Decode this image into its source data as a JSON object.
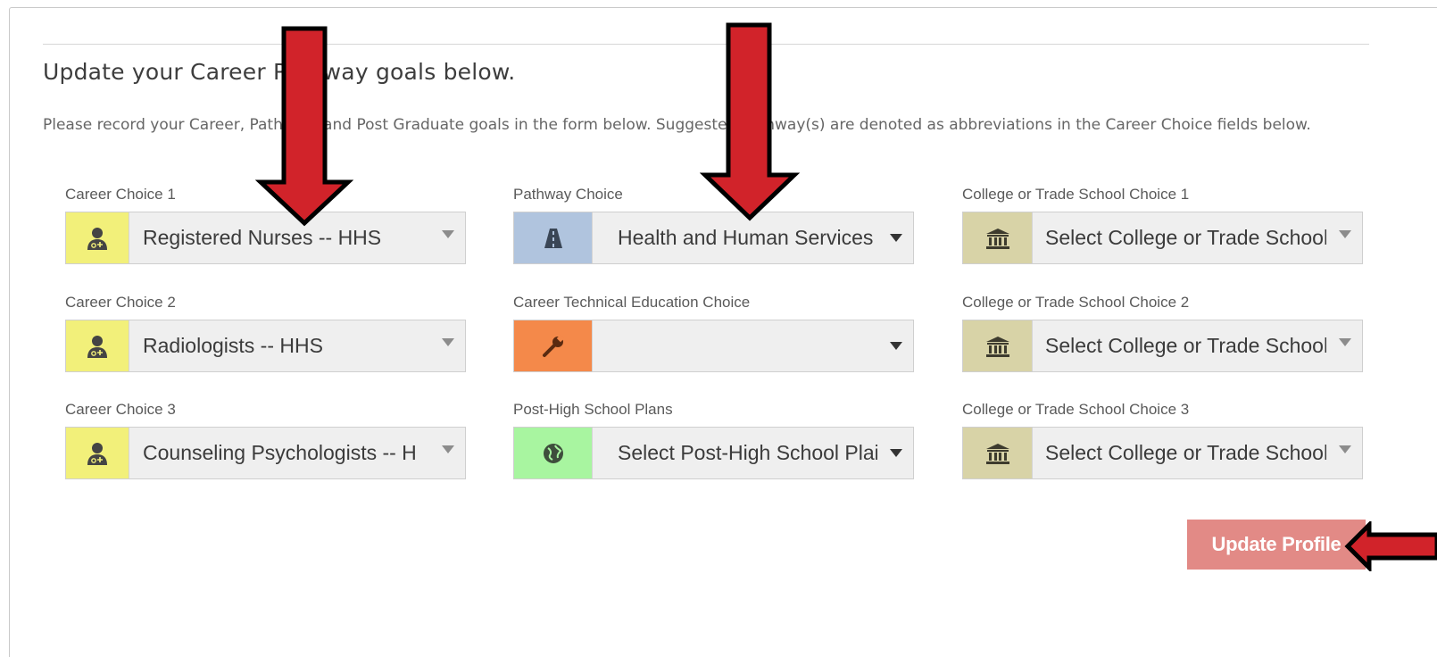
{
  "heading": "Update your Career Pathway goals below.",
  "intro": "Please record your Career, Pathway, and Post Graduate goals in the form below. Suggested Pathway(s) are denoted as abbreviations in the Career Choice fields below.",
  "colors": {
    "career_addon": "#f2f07a",
    "pathway_addon": "#b0c4de",
    "cte_addon": "#f4894a",
    "post_hs_addon": "#a8f5a0",
    "college_addon": "#d8d3a7",
    "update_button": "#e28a86",
    "annotation_arrow": "#d1232a"
  },
  "career_choices": [
    {
      "label": "Career Choice 1",
      "value": "Registered Nurses -- HHS",
      "icon": "doctor-icon"
    },
    {
      "label": "Career Choice 2",
      "value": "Radiologists -- HHS",
      "icon": "doctor-icon"
    },
    {
      "label": "Career Choice 3",
      "value": "Counseling Psychologists -- H",
      "icon": "doctor-icon"
    }
  ],
  "pathway": {
    "label": "Pathway Choice",
    "value": "Health and Human Services",
    "icon": "road-icon"
  },
  "cte": {
    "label": "Career Technical Education Choice",
    "value": "",
    "icon": "wrench-icon"
  },
  "post_hs": {
    "label": "Post-High School Plans",
    "value": "Select Post-High School Plai",
    "icon": "globe-icon"
  },
  "college_choices": [
    {
      "label": "College or Trade School Choice 1",
      "value": "Select College or Trade School",
      "icon": "institution-icon"
    },
    {
      "label": "College or Trade School Choice 2",
      "value": "Select College or Trade School",
      "icon": "institution-icon"
    },
    {
      "label": "College or Trade School Choice 3",
      "value": "Select College or Trade School",
      "icon": "institution-icon"
    }
  ],
  "update_button_label": "Update Profile"
}
